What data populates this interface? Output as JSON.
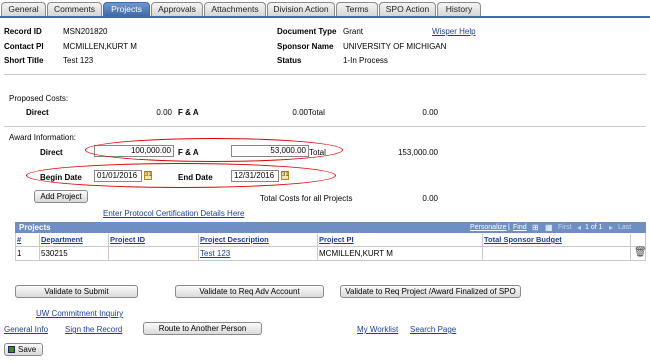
{
  "tabs": [
    "General",
    "Comments",
    "Projects",
    "Approvals",
    "Attachments",
    "Division Action",
    "Terms",
    "SPO Action",
    "History"
  ],
  "header": {
    "record_id_label": "Record ID",
    "record_id": "MSN201820",
    "contact_pi_label": "Contact PI",
    "contact_pi": "MCMILLEN,KURT M",
    "short_title_label": "Short Title",
    "short_title": "Test 123",
    "doc_type_label": "Document Type",
    "doc_type": "Grant",
    "wisper_help": "Wisper Help",
    "sponsor_name_label": "Sponsor Name",
    "sponsor_name": "UNIVERSITY OF MICHIGAN",
    "status_label": "Status",
    "status": "1-In Process"
  },
  "proposed": {
    "title": "Proposed Costs:",
    "direct_label": "Direct",
    "direct": "0.00",
    "fa_label": "F & A",
    "fa": "0.00",
    "total_label": "Total",
    "total": "0.00"
  },
  "award": {
    "title": "Award Information:",
    "direct_label": "Direct",
    "direct": "100,000.00",
    "fa_label": "F & A",
    "fa": "53,000.00",
    "total_label": "Total",
    "total": "153,000.00",
    "begin_label": "Begin Date",
    "begin": "01/01/2016",
    "end_label": "End Date",
    "end": "12/31/2016",
    "add_project": "Add Project",
    "total_costs_label": "Total Costs for all Projects",
    "total_costs": "0.00",
    "protocol_link": "Enter Protocol Certification Details Here"
  },
  "projects_grid": {
    "title": "Projects",
    "personalize": "Personalize",
    "find": "Find",
    "first": "First",
    "pager": "1 of 1",
    "last": "Last",
    "columns": [
      "#",
      "Department",
      "Project ID",
      "Project Description",
      "Project PI",
      "Total Sponsor Budget"
    ],
    "rows": [
      {
        "num": "1",
        "department": "530215",
        "project_id": "",
        "description": "Test 123",
        "pi": "MCMILLEN,KURT M",
        "budget": ""
      }
    ]
  },
  "actions": {
    "validate_submit": "Validate to Submit",
    "validate_req_adv": "Validate to Req Adv Account",
    "validate_req_project": "Validate to Req Project /Award Finalized of SPO",
    "uw_commitment": "UW Commitment Inquiry",
    "general_info": "General Info",
    "sign_record": "Sign the Record",
    "route": "Route to Another Person",
    "my_worklist": "My Worklist",
    "search_page": "Search Page",
    "save": "Save"
  },
  "colors": {
    "tab_active": "#3f6aa8",
    "grid_header": "#6f8fc4",
    "link": "#1b3f9a",
    "annotation": "#dd0000"
  }
}
